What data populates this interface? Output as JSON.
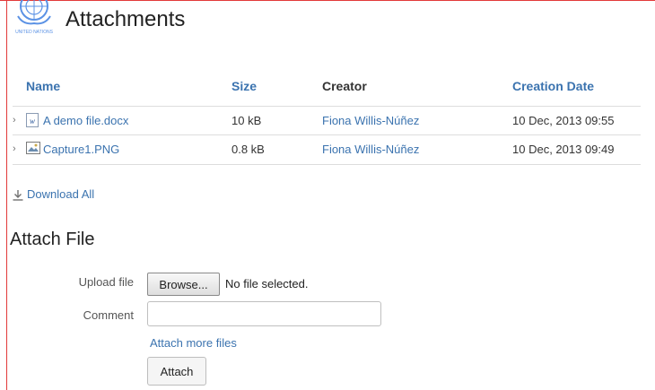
{
  "page": {
    "title": "Attachments",
    "logo_text": "UNITED NATIONS"
  },
  "table": {
    "columns": {
      "name": "Name",
      "size": "Size",
      "creator": "Creator",
      "date": "Creation Date"
    },
    "rows": [
      {
        "name": "A demo file.docx",
        "size": "10 kB",
        "creator": "Fiona Willis-Núñez",
        "date": "10 Dec, 2013 09:55",
        "icon": "word-file-icon"
      },
      {
        "name": "Capture1.PNG",
        "size": "0.8 kB",
        "creator": "Fiona Willis-Núñez",
        "date": "10 Dec, 2013 09:49",
        "icon": "image-file-icon"
      }
    ]
  },
  "download_all": "Download All",
  "attach": {
    "section_title": "Attach File",
    "upload_label": "Upload file",
    "browse_label": "Browse...",
    "no_file": "No file selected.",
    "comment_label": "Comment",
    "comment_value": "",
    "attach_more": "Attach more files",
    "attach_button": "Attach"
  },
  "colors": {
    "link": "#3b73af",
    "frame": "#e23a3a",
    "text": "#333333"
  }
}
